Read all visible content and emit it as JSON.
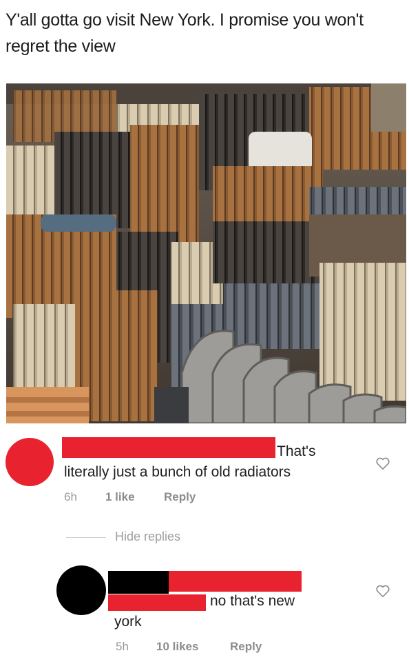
{
  "post": {
    "caption": "Y'all gotta go visit New York. I promise you won't regret the view"
  },
  "comments": [
    {
      "text_line1": "That's",
      "text_line2": "literally just a bunch of old radiators",
      "time": "6h",
      "likes": "1 like",
      "reply_label": "Reply",
      "avatar_color": "#e8222e"
    },
    {
      "text_line1": "no that's new",
      "text_line2": "york",
      "time": "5h",
      "likes": "10 likes",
      "reply_label": "Reply",
      "avatar_color": "#000000"
    }
  ],
  "replies_toggle": {
    "label": "Hide replies"
  },
  "colors": {
    "redaction_red": "#e8222e",
    "redaction_black": "#000000",
    "meta_gray": "#9a9a9a"
  },
  "icons": {
    "like": "heart-outline-icon"
  }
}
